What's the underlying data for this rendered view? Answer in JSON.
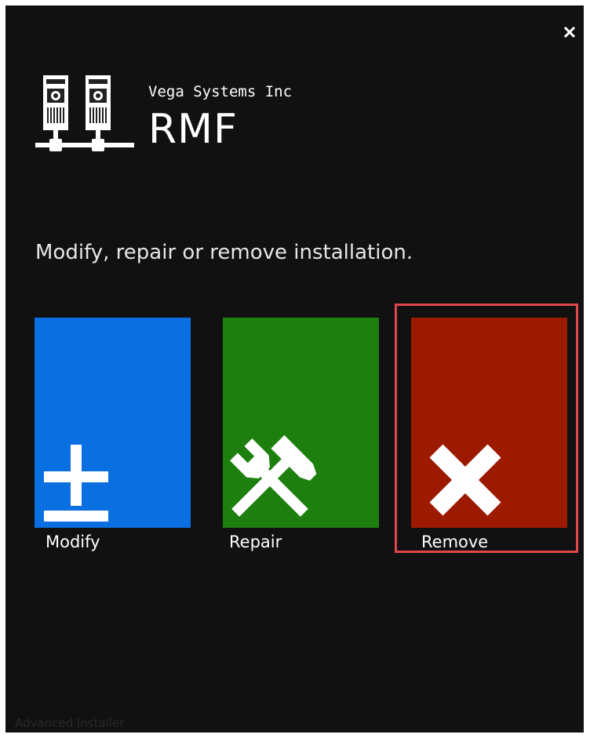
{
  "window": {
    "close_symbol": "×",
    "company": "Vega Systems Inc",
    "product": "RMF",
    "logo_icon": "server-network-icon",
    "prompt": "Modify, repair or remove installation.",
    "footer": "Advanced Installer"
  },
  "options": [
    {
      "label": "Modify",
      "icon": "plus-minus-icon",
      "color": "#0a6fe0"
    },
    {
      "label": "Repair",
      "icon": "wrench-hammer-icon",
      "color": "#1d7f0e"
    },
    {
      "label": "Remove",
      "icon": "x-icon",
      "color": "#9c1b00",
      "selected": true
    }
  ],
  "colors": {
    "background": "#111111",
    "selection_outline": "#e0474c"
  }
}
